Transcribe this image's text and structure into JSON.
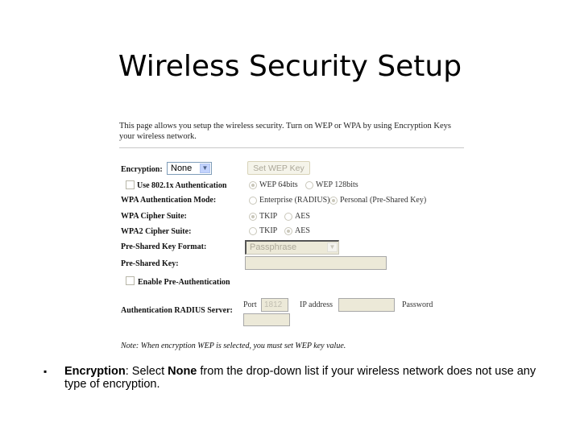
{
  "slide": {
    "title": "Wireless Security Setup"
  },
  "panel": {
    "intro": "This page allows you setup the wireless security. Turn on WEP or WPA by using Encryption Keys your wireless network.",
    "encryption": {
      "label": "Encryption:",
      "selected": "None",
      "set_wep_key_button": "Set WEP Key"
    },
    "use_8021x": {
      "label": "Use 802.1x Authentication",
      "checked": false,
      "options": [
        {
          "label": "WEP 64bits",
          "selected": true
        },
        {
          "label": "WEP 128bits",
          "selected": false
        }
      ]
    },
    "wpa_auth_mode": {
      "label": "WPA Authentication Mode:",
      "options": [
        {
          "label": "Enterprise (RADIUS)",
          "selected": false
        },
        {
          "label": "Personal (Pre-Shared Key)",
          "selected": true
        }
      ]
    },
    "wpa_cipher": {
      "label": "WPA Cipher Suite:",
      "options": [
        {
          "label": "TKIP",
          "selected": true
        },
        {
          "label": "AES",
          "selected": false
        }
      ]
    },
    "wpa2_cipher": {
      "label": "WPA2 Cipher Suite:",
      "options": [
        {
          "label": "TKIP",
          "selected": false
        },
        {
          "label": "AES",
          "selected": true
        }
      ]
    },
    "psk_format": {
      "label": "Pre-Shared Key Format:",
      "selected": "Passphrase"
    },
    "psk": {
      "label": "Pre-Shared Key:",
      "value": ""
    },
    "pre_auth": {
      "label": "Enable Pre-Authentication",
      "checked": false
    },
    "radius": {
      "label": "Authentication RADIUS Server:",
      "port_label": "Port",
      "port_value": "1812",
      "ip_label": "IP address",
      "ip_value": "",
      "password_label": "Password",
      "password_value": ""
    },
    "note": "Note: When encryption WEP is selected, you must set WEP key value."
  },
  "bullet": {
    "marker": "▪",
    "term": "Encryption",
    "sep": ": Select ",
    "keyword": "None",
    "rest": " from the drop-down list if your wireless network does not use any type of encryption."
  }
}
